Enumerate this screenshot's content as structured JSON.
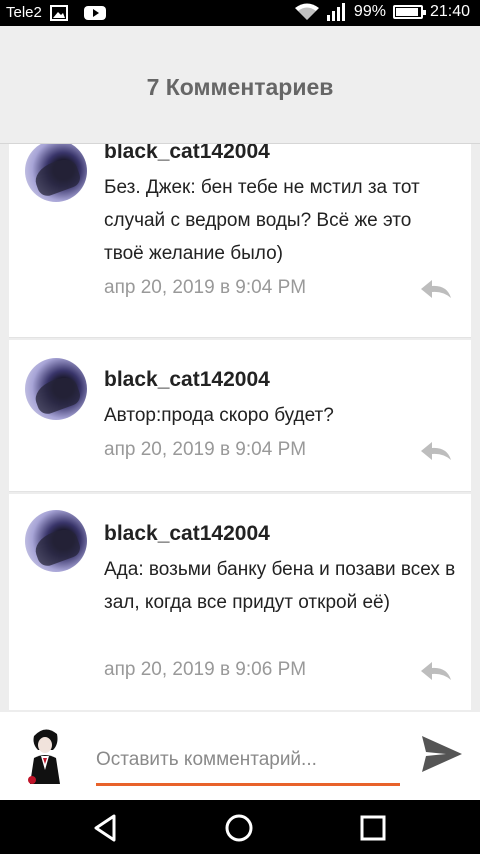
{
  "status_bar": {
    "carrier": "Tele2",
    "battery_percent": "99%",
    "battery_level": 0.99,
    "time": "21:40",
    "icons": [
      "image-icon",
      "youtube-icon",
      "wifi-icon",
      "signal-icon",
      "battery-icon"
    ]
  },
  "header": {
    "title": "7 Комментариев"
  },
  "comments": [
    {
      "author": "black_cat142004",
      "text": "Без. Джек: бен тебе не мстил за тот случай с ведром воды? Всё же это твоё желание было)",
      "date": "апр 20, 2019 в 9:04 PM"
    },
    {
      "author": "black_cat142004",
      "text": "Автор:прода скоро будет?",
      "date": "апр 20, 2019 в 9:04 PM"
    },
    {
      "author": "black_cat142004",
      "text": "Ада: возьми банку бена и позави всех в зал, когда все придут открой её)",
      "date": "апр 20, 2019 в 9:06 PM"
    }
  ],
  "comment_input": {
    "placeholder": "Оставить комментарий...",
    "value": ""
  },
  "colors": {
    "accent": "#e8622a",
    "header_bg": "#eeeeee",
    "header_text": "#666666",
    "date_text": "#999999"
  }
}
